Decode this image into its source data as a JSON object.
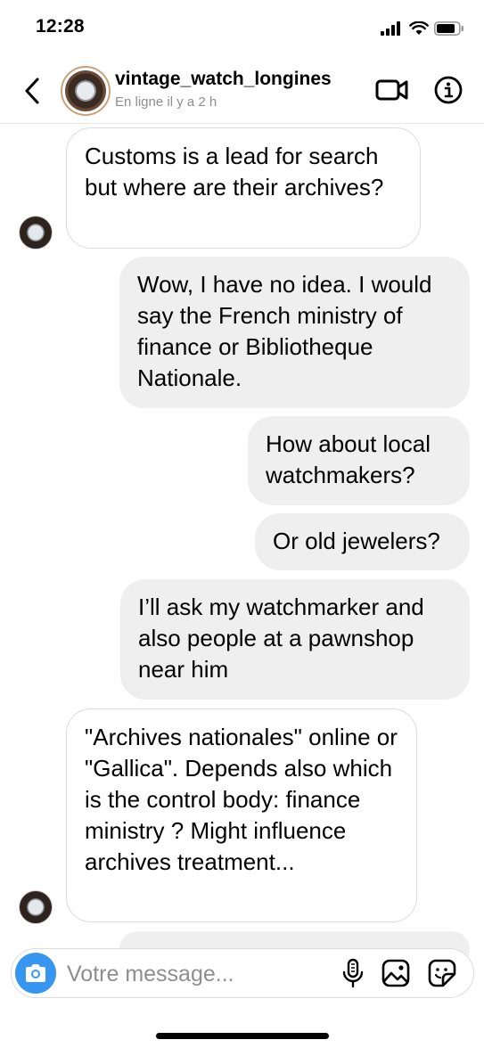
{
  "status_bar": {
    "time": "12:28"
  },
  "header": {
    "username": "vintage_watch_longines",
    "presence": "En ligne il y a 2 h"
  },
  "messages": [
    {
      "direction": "incoming",
      "text": "Customs is a lead for search but where are their archives?"
    },
    {
      "direction": "outgoing",
      "text": "Wow, I have no idea. I would say the French ministry of finance or Bibliotheque Nationale."
    },
    {
      "direction": "outgoing",
      "text": "How about local watchmakers?"
    },
    {
      "direction": "outgoing",
      "text": "Or old jewelers?"
    },
    {
      "direction": "outgoing",
      "text": "I’ll ask my watchmarker and also people at a pawnshop near him"
    },
    {
      "direction": "incoming",
      "text": "\"Archives nationales\" online or \"Gallica\". Depends also which is the control body: finance ministry ? Might influence archives treatment..."
    }
  ],
  "composer": {
    "placeholder": "Votre message..."
  },
  "icons": {
    "back": "chevron-left-icon",
    "video": "video-camera-icon",
    "info": "info-icon",
    "camera": "camera-icon",
    "mic": "microphone-icon",
    "gallery": "image-icon",
    "sticker": "sticker-icon"
  },
  "colors": {
    "incoming_bubble": "#ffffff",
    "outgoing_bubble": "#efefef",
    "camera_button": "#3797f0",
    "secondary_text": "#8e8e8e"
  }
}
